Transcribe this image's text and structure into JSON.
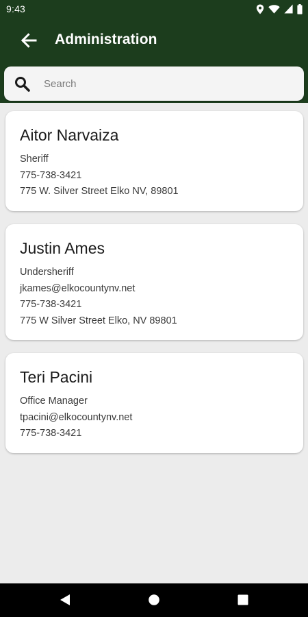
{
  "status_bar": {
    "time": "9:43",
    "icons": [
      "location-icon",
      "wifi-icon",
      "signal-icon",
      "battery-icon"
    ]
  },
  "app_bar": {
    "title": "Administration",
    "back_icon": "arrow-back-icon"
  },
  "search": {
    "placeholder": "Search",
    "value": "",
    "icon": "search-icon"
  },
  "contacts": [
    {
      "name": "Aitor Narvaiza",
      "lines": [
        "Sheriff",
        "775-738-3421",
        "775 W. Silver Street Elko NV, 89801"
      ]
    },
    {
      "name": "Justin Ames",
      "lines": [
        "Undersheriff",
        "jkames@elkocountynv.net",
        "775-738-3421",
        "775 W Silver Street Elko, NV 89801"
      ]
    },
    {
      "name": "Teri Pacini",
      "lines": [
        "Office Manager",
        "tpacini@elkocountynv.net",
        "775-738-3421"
      ]
    }
  ],
  "nav_bar": {
    "buttons": [
      "nav-back-icon",
      "nav-home-icon",
      "nav-recents-icon"
    ]
  },
  "colors": {
    "header_green": "#1c3d1d",
    "background": "#ececec",
    "card": "#ffffff",
    "nav_bar": "#000000"
  }
}
